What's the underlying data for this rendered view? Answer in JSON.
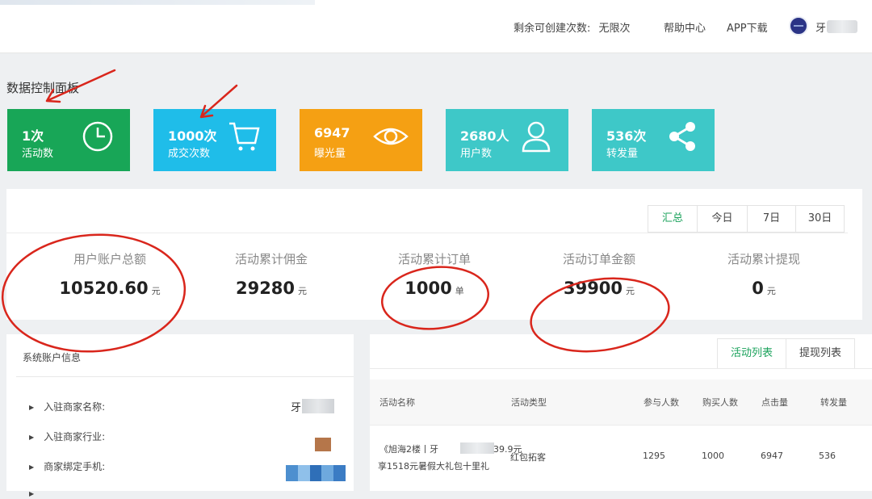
{
  "topbar": {
    "quota_label": "剩余可创建次数:",
    "quota_value": "无限次",
    "help": "帮助中心",
    "app_download": "APP下载",
    "username": "牙"
  },
  "dashboard_title": "数据控制面板",
  "cards": [
    {
      "value": "1次",
      "label": "活动数",
      "color": "#18a657",
      "icon": "clock-icon"
    },
    {
      "value": "1000次",
      "label": "成交次数",
      "color": "#1fbde9",
      "icon": "cart-icon"
    },
    {
      "value": "6947",
      "label": "曝光量",
      "color": "#f5a013",
      "icon": "eye-icon"
    },
    {
      "value": "2680人",
      "label": "用户数",
      "color": "#3ec8c8",
      "icon": "user-icon"
    },
    {
      "value": "536次",
      "label": "转发量",
      "color": "#3ec8c8",
      "icon": "share-icon"
    }
  ],
  "period_tabs": [
    "汇总",
    "今日",
    "7日",
    "30日"
  ],
  "summary_stats": [
    {
      "label": "用户账户总额",
      "value": "10520.60",
      "unit": "元"
    },
    {
      "label": "活动累计佣金",
      "value": "29280",
      "unit": "元"
    },
    {
      "label": "活动累计订单",
      "value": "1000",
      "unit": "单"
    },
    {
      "label": "活动订单金额",
      "value": "39900",
      "unit": "元"
    },
    {
      "label": "活动累计提现",
      "value": "0",
      "unit": "元"
    }
  ],
  "account": {
    "title": "系统账户信息",
    "rows": [
      "入驻商家名称:",
      "入驻商家行业:",
      "商家绑定手机:"
    ],
    "merchant_name": "牙"
  },
  "list": {
    "tabs": [
      "活动列表",
      "提现列表"
    ],
    "columns": [
      "活动名称",
      "活动类型",
      "参与人数",
      "购买人数",
      "点击量",
      "转发量"
    ],
    "rows": [
      {
        "name_line1": "《旭海2楼丨牙",
        "name_line1_end": "39.9元",
        "name_line2": "享1518元暑假大礼包十里礼",
        "type": "红包拓客",
        "participants": "1295",
        "buyers": "1000",
        "clicks": "6947",
        "shares": "536"
      }
    ]
  },
  "colors": {
    "accent_green": "#1aa25b",
    "annotation_red": "#d9261c"
  }
}
